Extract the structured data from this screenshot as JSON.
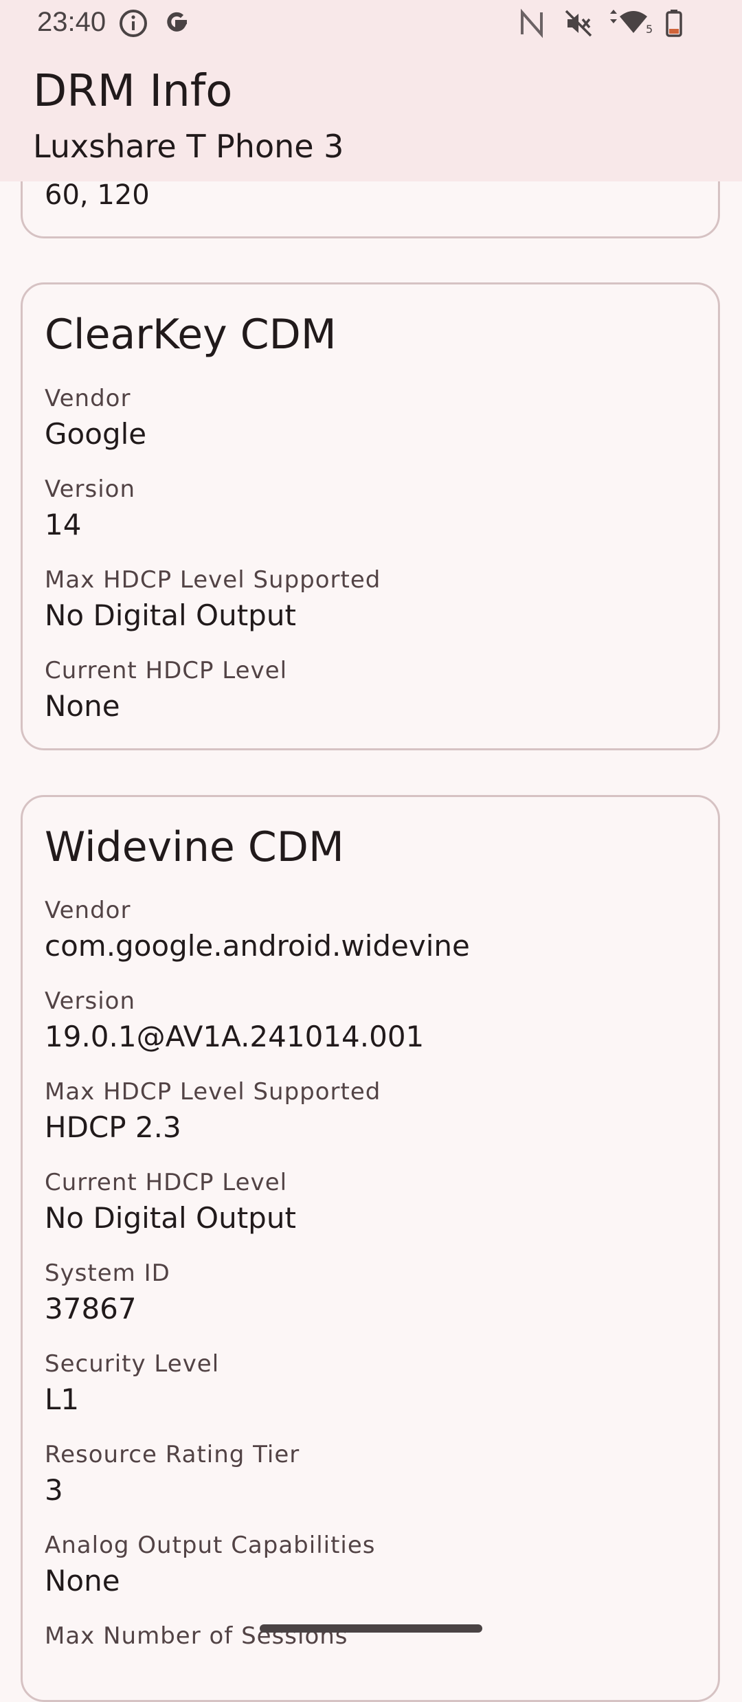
{
  "status_bar": {
    "time": "23:40",
    "left_icons": [
      "info-icon",
      "google-g-icon"
    ],
    "right_icons": [
      "nfc-icon",
      "mute-icon",
      "wifi-icon",
      "battery-icon"
    ]
  },
  "app_bar": {
    "title": "DRM Info",
    "subtitle": "Luxshare T Phone 3"
  },
  "partial_card": {
    "value": "60, 120"
  },
  "clearkey": {
    "title": "ClearKey CDM",
    "fields": [
      {
        "label": "Vendor",
        "value": "Google"
      },
      {
        "label": "Version",
        "value": "14"
      },
      {
        "label": "Max HDCP Level Supported",
        "value": "No Digital Output"
      },
      {
        "label": "Current HDCP Level",
        "value": "None"
      }
    ]
  },
  "widevine": {
    "title": "Widevine CDM",
    "fields": [
      {
        "label": "Vendor",
        "value": "com.google.android.widevine"
      },
      {
        "label": "Version",
        "value": "19.0.1@AV1A.241014.001"
      },
      {
        "label": "Max HDCP Level Supported",
        "value": "HDCP 2.3"
      },
      {
        "label": "Current HDCP Level",
        "value": "No Digital Output"
      },
      {
        "label": "System ID",
        "value": "37867"
      },
      {
        "label": "Security Level",
        "value": "L1"
      },
      {
        "label": "Resource Rating Tier",
        "value": "3"
      },
      {
        "label": "Analog Output Capabilities",
        "value": "None"
      },
      {
        "label": "Max Number of Sessions",
        "value": ""
      }
    ]
  },
  "colors": {
    "app_bar_bg": "#f8e8e9",
    "page_bg": "#fcf6f6",
    "card_border": "#d6c2c3",
    "text_primary": "#211a1b",
    "text_label": "#524345"
  }
}
